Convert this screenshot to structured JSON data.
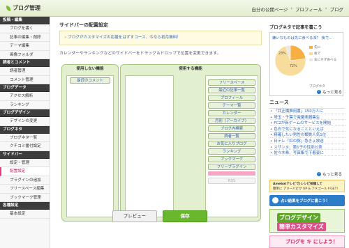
{
  "header": {
    "logo": "ブログ管理",
    "nav": [
      "自分の公開ページ",
      "プロフィール",
      "ブログ"
    ]
  },
  "sidebar": {
    "sections": [
      {
        "title": "投稿・編集",
        "items": [
          "ブログを書く",
          "記事の編集・削除",
          "テーマ編集",
          "画像フォルダ"
        ]
      },
      {
        "title": "読者とコメント",
        "items": [
          "読者管理",
          "コメント管理"
        ]
      },
      {
        "title": "ブログデータ",
        "items": [
          "アクセス解析",
          "ランキング"
        ]
      },
      {
        "title": "ブログデザイン",
        "items": [
          "デザインの変更"
        ]
      },
      {
        "title": "ブログネタ",
        "items": [
          "ブログネタ一覧",
          "クチコミ番付設定"
        ]
      },
      {
        "title": "サイドバー",
        "items": [
          "設定・管理",
          "配置設定",
          "プラグインの追加",
          "フリースペース編集",
          "ブックマーク管理"
        ]
      },
      {
        "title": "各種設定",
        "items": [
          "基本設定"
        ]
      }
    ],
    "active_item": "配置設定"
  },
  "main": {
    "title": "サイドバーの配置設定",
    "notice_prefix": "»",
    "notice": "ブログがカスタマイズの応援をはずすコース、今なら初月無料！",
    "description": "カレンダーやランキングなどのサイドバーをドラッグ＆ドロップで位置を変更できます。",
    "unused": {
      "header": "使用しない機能",
      "items": [
        "最近のコメント"
      ]
    },
    "used": {
      "header": "使用する機能",
      "items": [
        "フリースペース",
        "最近の記事一覧",
        "プロフィール",
        "テーマ一覧",
        "カレンダー",
        "月別（アーカイブ）",
        "ブログ内検索",
        "読者一覧",
        "お気に入りブログ",
        "ランキング",
        "ブックマーク",
        "フリープラグイン"
      ],
      "disabled_item": "RSS"
    },
    "buttons": {
      "preview": "プレビュー",
      "save": "保存"
    }
  },
  "rail": {
    "title": "ブログネタで記事を書こう",
    "poll": {
      "question": "嫌いなものは先に食べる派？ 後で…",
      "legend": [
        "先に",
        "後で",
        "気にせず食べる"
      ],
      "values_percent": [
        23,
        72,
        5
      ],
      "labels": [
        "23%",
        "72%"
      ],
      "brand": "ブログネタ",
      "colors": [
        "#f5b041",
        "#f7dc9c",
        "#e8e8e8"
      ]
    },
    "more_label": "もっと見る",
    "news_title": "ニュース",
    "news": [
      "「井正橋推用書」150万人に",
      "埼玉・千葉で電量楽器集生",
      "FC2が新ゲームのサービスを開始",
      "色白で気になることといえば",
      "精確したい男性の類質人気1位",
      "日テレ「紅の豚」急きょ放送",
      "スザンヌ、第1子の性別公表",
      "佐々木希、写真集で下着姿に"
    ],
    "banner1": {
      "line1": "Ameba(テレビで)レシピ投稿して",
      "line2": "簡単に アメーバピグ UP & アメゴールドGET!"
    },
    "banner2": "占い結果をブログに書こう！",
    "banner3": {
      "line1": "ブログデザイン",
      "line2": "簡単カスタマイズ"
    },
    "banner4": "ブログを キ にしよう！"
  }
}
